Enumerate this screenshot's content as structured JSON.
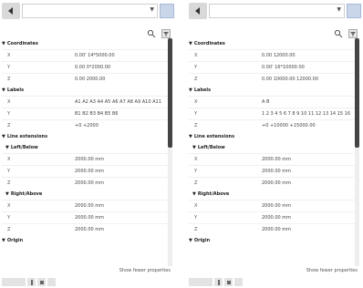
{
  "panels": [
    {
      "show_fewer": "Show fewer properties",
      "sections": {
        "coordinates": {
          "title": "Coordinates",
          "rows": [
            {
              "label": "X",
              "value": "0.00' 14*5000.00"
            },
            {
              "label": "Y",
              "value": "0.00 0*2000.00"
            },
            {
              "label": "Z",
              "value": "0.00 2000.00"
            }
          ]
        },
        "labels": {
          "title": "Labels",
          "rows": [
            {
              "label": "X",
              "value": "A1 A2 A3 A4 A5 A6 A7 A8 A9 A10 A11"
            },
            {
              "label": "Y",
              "value": "B1 B2 B3 B4 B5 B6"
            },
            {
              "label": "Z",
              "value": "+0 +2000"
            }
          ]
        },
        "line_extensions": {
          "title": "Line extensions",
          "left_below": {
            "title": "Left/Below",
            "rows": [
              {
                "label": "X",
                "value": "2000.00 mm"
              },
              {
                "label": "Y",
                "value": "2000.00 mm"
              },
              {
                "label": "Z",
                "value": "2000.00 mm"
              }
            ]
          },
          "right_above": {
            "title": "Right/Above",
            "rows": [
              {
                "label": "X",
                "value": "2000.00 mm"
              },
              {
                "label": "Y",
                "value": "2000.00 mm"
              },
              {
                "label": "Z",
                "value": "2000.00 mm"
              }
            ]
          }
        },
        "origin": {
          "title": "Origin"
        }
      }
    },
    {
      "show_fewer": "Show fewer properties",
      "sections": {
        "coordinates": {
          "title": "Coordinates",
          "rows": [
            {
              "label": "X",
              "value": "0.00 12000.00"
            },
            {
              "label": "Y",
              "value": "0.00' 16*10000.00"
            },
            {
              "label": "Z",
              "value": "0.00 10000.00 12000.00"
            }
          ]
        },
        "labels": {
          "title": "Labels",
          "rows": [
            {
              "label": "X",
              "value": "A B"
            },
            {
              "label": "Y",
              "value": "1 2 3 4 5 6 7 8 9 10 11 12 13 14 15 16"
            },
            {
              "label": "Z",
              "value": "+0 +10000 +15000.00"
            }
          ]
        },
        "line_extensions": {
          "title": "Line extensions",
          "left_below": {
            "title": "Left/Below",
            "rows": [
              {
                "label": "X",
                "value": "2000.00 mm"
              },
              {
                "label": "Y",
                "value": "2000.00 mm"
              },
              {
                "label": "Z",
                "value": "2000.00 mm"
              }
            ]
          },
          "right_above": {
            "title": "Right/Above",
            "rows": [
              {
                "label": "X",
                "value": "2000.00 mm"
              },
              {
                "label": "Y",
                "value": "2000.00 mm"
              },
              {
                "label": "Z",
                "value": "2000.00 mm"
              }
            ]
          }
        },
        "origin": {
          "title": "Origin"
        }
      }
    }
  ],
  "icons": {
    "back": "arrow-left-icon",
    "dropdown": "chevron-down-icon",
    "search": "search-icon",
    "filter": "filter-icon"
  },
  "colors": {
    "accent_button": "#c9d6ea",
    "scroll_thumb": "#444444",
    "toolbar_gray": "#d9d9d9"
  }
}
